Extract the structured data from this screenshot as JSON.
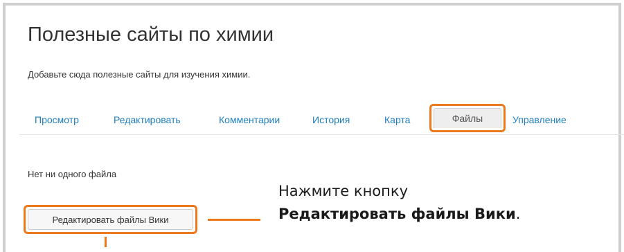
{
  "page": {
    "title": "Полезные сайты по химии",
    "description": "Добавьте сюда полезные сайты для изучения химии."
  },
  "tabs": [
    {
      "label": "Просмотр",
      "active": false
    },
    {
      "label": "Редактировать",
      "active": false
    },
    {
      "label": "Комментарии",
      "active": false
    },
    {
      "label": "История",
      "active": false
    },
    {
      "label": "Карта",
      "active": false
    },
    {
      "label": "Файлы",
      "active": true
    },
    {
      "label": "Управление",
      "active": false
    }
  ],
  "files": {
    "empty_message": "Нет ни одного файла",
    "edit_button_label": "Редактировать файлы Вики"
  },
  "callout": {
    "line1": "Нажмите кнопку",
    "line2_bold": "Редактировать файлы Вики",
    "line2_suffix": "."
  },
  "colors": {
    "highlight": "#ec7a1c",
    "link": "#1f7fbf",
    "text": "#333333"
  }
}
